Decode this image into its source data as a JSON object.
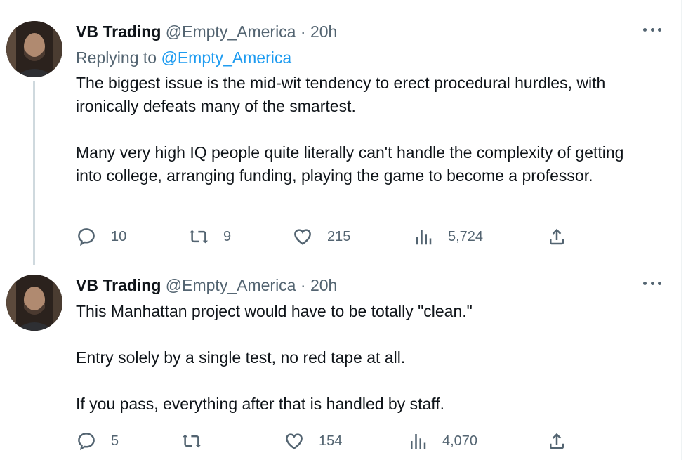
{
  "tweets": [
    {
      "author": {
        "name": "VB Trading",
        "handle": "@Empty_America",
        "separator": "·",
        "time": "20h"
      },
      "replying_prefix": "Replying to",
      "replying_to": "@Empty_America",
      "paragraphs": [
        "The biggest issue is the mid-wit tendency to erect procedural hurdles, with ironically defeats many of the smartest.",
        "Many very high IQ people quite literally can't handle the complexity of getting into college, arranging funding, playing the game to become a professor."
      ],
      "metrics": {
        "replies": "10",
        "reposts": "9",
        "likes": "215",
        "views": "5,724"
      }
    },
    {
      "author": {
        "name": "VB Trading",
        "handle": "@Empty_America",
        "separator": "·",
        "time": "20h"
      },
      "paragraphs": [
        "This Manhattan project would have to be totally \"clean.\"",
        "Entry solely by a single test, no red tape at all.",
        "If you pass, everything after that is handled by staff."
      ],
      "metrics": {
        "replies": "5",
        "reposts": "",
        "likes": "154",
        "views": "4,070"
      }
    }
  ],
  "icons": {
    "reply": "speech-bubble-icon",
    "repost": "repost-arrows-icon",
    "like": "heart-icon",
    "views": "bar-chart-icon",
    "share": "share-upload-icon",
    "more": "more-dots-icon"
  },
  "colors": {
    "text": "#0f1419",
    "secondary": "#536471",
    "link": "#1d9bf0",
    "thread": "#cfd9de"
  }
}
